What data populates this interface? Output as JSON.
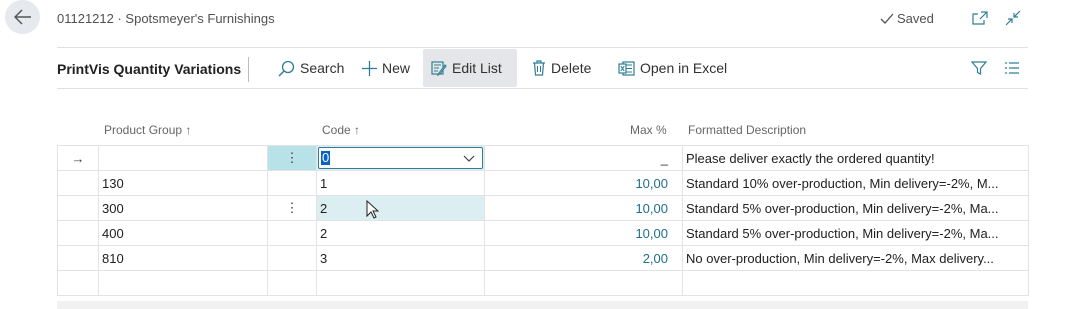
{
  "header": {
    "breadcrumb": "01121212 · Spotsmeyer's Furnishings",
    "saved_label": "Saved"
  },
  "toolbar": {
    "title": "PrintVis Quantity Variations",
    "actions": {
      "search": "Search",
      "new": "New",
      "edit_list": "Edit List",
      "delete": "Delete",
      "open_in_excel": "Open in Excel"
    }
  },
  "columns": {
    "product_group": "Product Group ↑",
    "code": "Code ↑",
    "max_pct": "Max %",
    "formatted_description": "Formatted Description"
  },
  "rows": [
    {
      "indicator": "→",
      "product_group": "",
      "code": "0",
      "max_pct": "_",
      "description": "Please deliver exactly the ordered quantity!"
    },
    {
      "indicator": "",
      "product_group": "130",
      "code": "1",
      "max_pct": "10,00",
      "description": "Standard 10% over-production, Min delivery=-2%, M..."
    },
    {
      "indicator": "",
      "product_group": "300",
      "code": "2",
      "max_pct": "10,00",
      "description": "Standard 5% over-production, Min delivery=-2%, Ma..."
    },
    {
      "indicator": "",
      "product_group": "400",
      "code": "2",
      "max_pct": "10,00",
      "description": "Standard 5% over-production, Min delivery=-2%, Ma..."
    },
    {
      "indicator": "",
      "product_group": "810",
      "code": "3",
      "max_pct": "2,00",
      "description": "No over-production, Min delivery=-2%, Max delivery..."
    }
  ],
  "row_menu_glyph": "⋮",
  "colors": {
    "accent": "#2f7e95",
    "selected_row": "#dbeef1",
    "number_text": "#1f6f8b"
  }
}
